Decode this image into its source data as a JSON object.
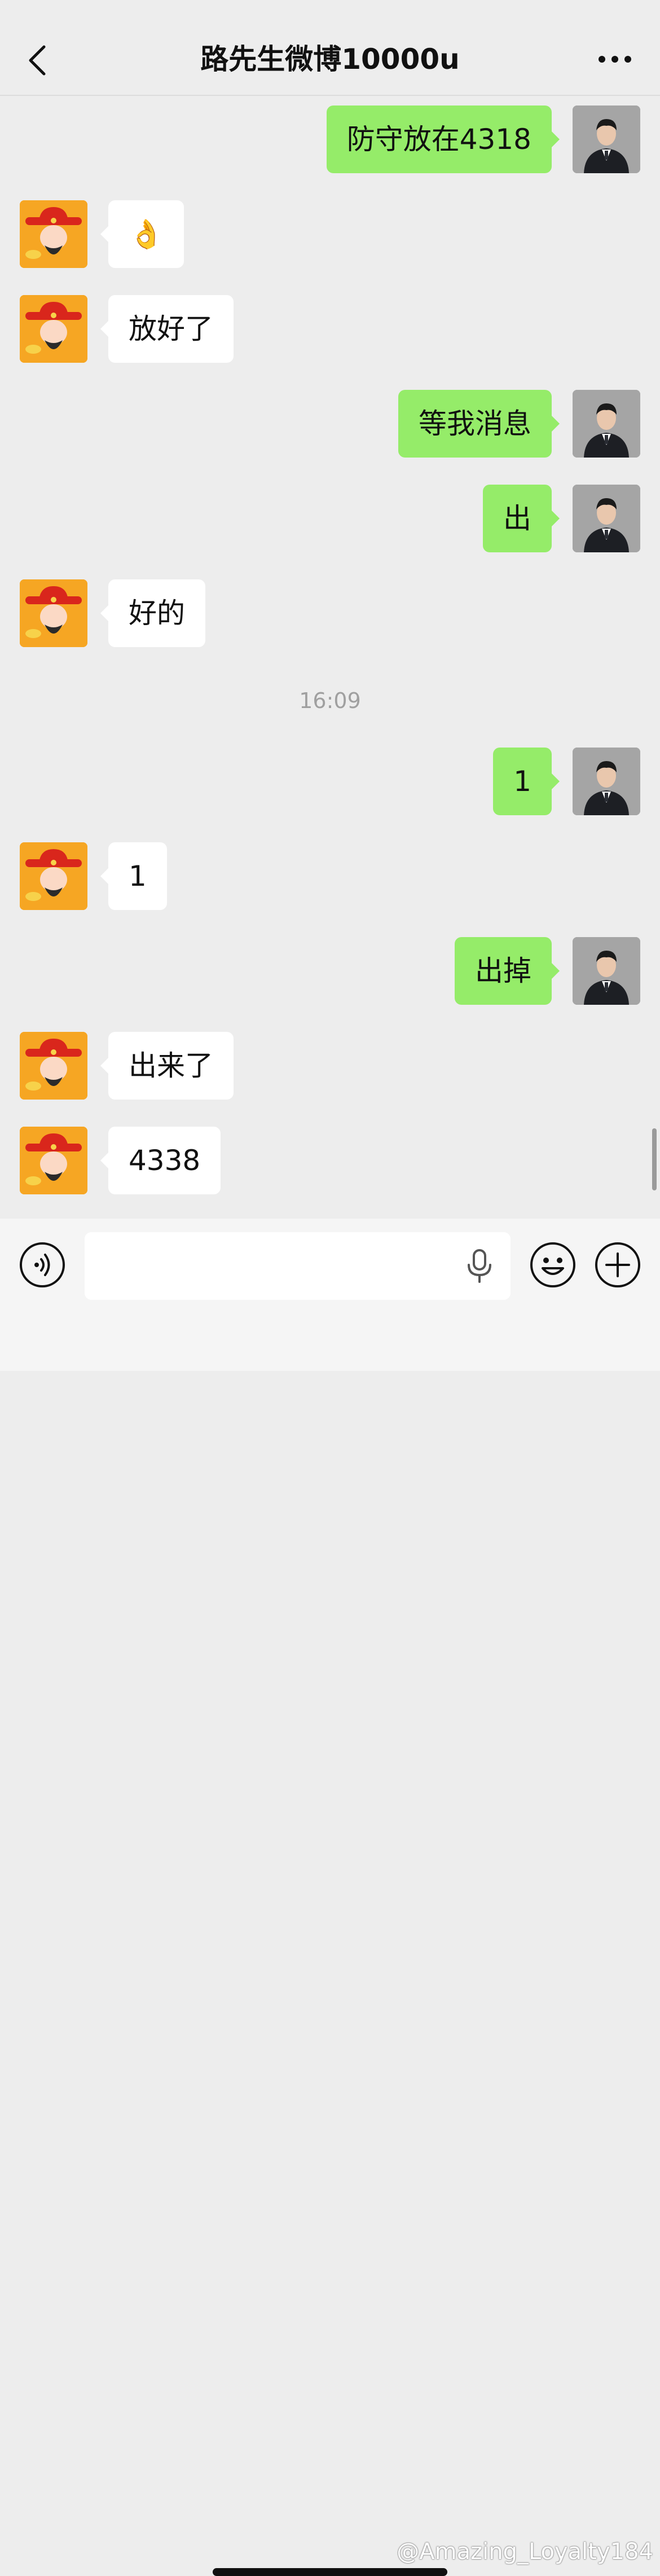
{
  "header": {
    "title": "路先生微博10000u",
    "back_icon": "chevron-left-icon",
    "more_icon": "more-dots-icon"
  },
  "messages": [
    {
      "side": "right",
      "text": "防守放在4318"
    },
    {
      "side": "left",
      "text": "👌"
    },
    {
      "side": "left",
      "text": "放好了"
    },
    {
      "side": "right",
      "text": "等我消息"
    },
    {
      "side": "right",
      "text": "出"
    },
    {
      "side": "left",
      "text": "好的"
    },
    {
      "side": "right",
      "text": "1"
    },
    {
      "side": "left",
      "text": "1"
    },
    {
      "side": "right",
      "text": "出掉"
    },
    {
      "side": "left",
      "text": "出来了"
    },
    {
      "side": "left",
      "text": "4338"
    }
  ],
  "timestamp": "16:09",
  "input": {
    "placeholder": "",
    "value": ""
  },
  "icons": {
    "voice": "voice-icon",
    "mic": "microphone-icon",
    "emoji": "emoji-icon",
    "plus": "plus-icon"
  },
  "watermark": "@Amazing_Loyalty184",
  "colors": {
    "outgoing_bubble": "#95ec69",
    "incoming_bubble": "#ffffff",
    "background": "#ededed",
    "incoming_avatar": "#f6a623",
    "outgoing_avatar": "#a5a5a5"
  }
}
